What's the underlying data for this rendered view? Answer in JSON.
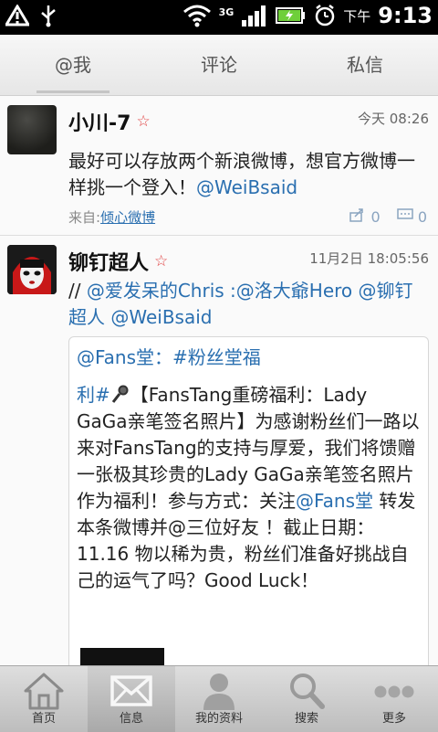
{
  "status_bar": {
    "network": "3G",
    "ampm": "下午",
    "time": "9:13"
  },
  "tabs": [
    {
      "label": "@我",
      "active": true
    },
    {
      "label": "评论",
      "active": false
    },
    {
      "label": "私信",
      "active": false
    }
  ],
  "posts": [
    {
      "name": "小川-7",
      "time": "今天 08:26",
      "text": "最好可以存放两个新浪微博，想官方微博一样挑一个登入！",
      "mention": "@WeiBsaid",
      "source_prefix": "来自:",
      "source": "倾心微博",
      "repost_count": "0",
      "comment_count": "0"
    },
    {
      "name": "铆钉超人",
      "time": "11月2日 18:05:56",
      "text_prefix": "// ",
      "text_mentions": "@爱发呆的Chris :@洛大爺Hero @铆钉超人 @WeiBsaid",
      "quote_line1": "@Fans堂：#粉丝堂福",
      "quote_line2_prefix": "利#",
      "quote_body": "【FansTang重磅福利：Lady GaGa亲笔签名照片】为感谢粉丝们一路以来对FansTang的支持与厚爱，我们将馈赠一张极其珍贵的Lady GaGa亲笔签名照片作为福利！参与方式：关注",
      "quote_mention": "@Fans堂",
      "quote_tail": " 转发本条微博并@三位好友 ！截止日期：11.16 物以稀为贵，粉丝们准备好挑战自己的运气了吗？Good Luck！"
    }
  ],
  "bottom_nav": [
    {
      "label": "首页",
      "icon": "home-icon",
      "active": false
    },
    {
      "label": "信息",
      "icon": "envelope-icon",
      "active": true
    },
    {
      "label": "我的资料",
      "icon": "person-icon",
      "active": false
    },
    {
      "label": "搜索",
      "icon": "search-icon",
      "active": false
    },
    {
      "label": "更多",
      "icon": "more-icon",
      "active": false
    }
  ],
  "colors": {
    "link": "#2a6fb0",
    "star": "#e04040",
    "battery": "#6fcf3a"
  }
}
